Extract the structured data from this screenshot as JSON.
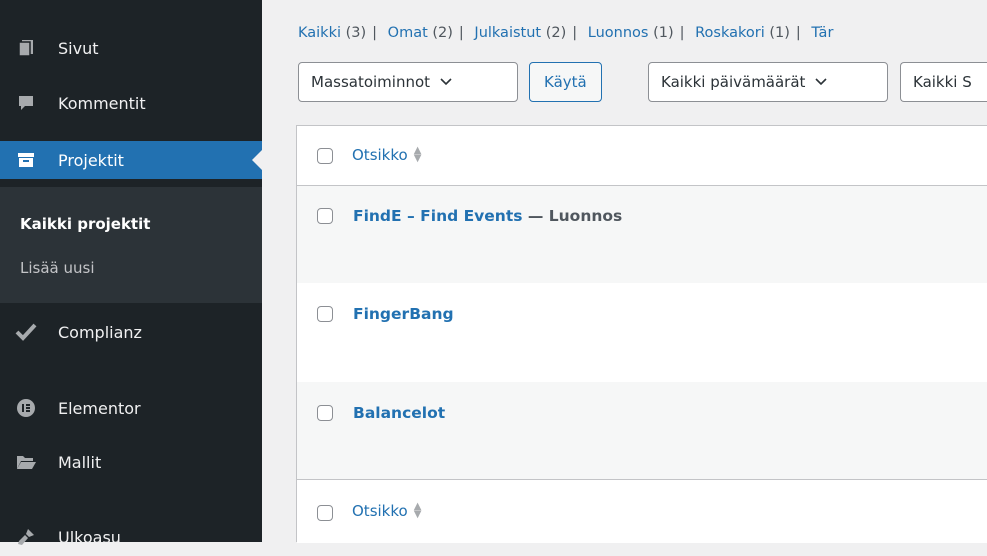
{
  "sidebar": {
    "items": [
      {
        "label": "Sivut",
        "icon": "pages-icon"
      },
      {
        "label": "Kommentit",
        "icon": "comments-icon"
      },
      {
        "label": "Projektit",
        "icon": "projects-icon",
        "active": true
      },
      {
        "label": "Complianz",
        "icon": "checkmark-icon"
      },
      {
        "label": "Elementor",
        "icon": "elementor-icon"
      },
      {
        "label": "Mallit",
        "icon": "folder-icon"
      },
      {
        "label": "Ulkoasu",
        "icon": "brush-icon"
      }
    ],
    "submenu": {
      "current": "Kaikki projektit",
      "add_new": "Lisää uusi"
    }
  },
  "views": [
    {
      "label": "Kaikki",
      "count": "(3)"
    },
    {
      "label": "Omat",
      "count": "(2)"
    },
    {
      "label": "Julkaistut",
      "count": "(2)"
    },
    {
      "label": "Luonnos",
      "count": "(1)"
    },
    {
      "label": "Roskakori",
      "count": "(1)"
    },
    {
      "label": "Tär",
      "count": ""
    }
  ],
  "toolbar": {
    "bulk_actions": "Massatoiminnot",
    "apply": "Käytä",
    "dates": "Kaikki päivämäärät",
    "category": "Kaikki S"
  },
  "table": {
    "column_title": "Otsikko",
    "rows": [
      {
        "title": "FindE – Find Events",
        "state": " — Luonnos"
      },
      {
        "title": "FingerBang",
        "state": ""
      },
      {
        "title": "Balancelot",
        "state": ""
      }
    ]
  },
  "colors": {
    "sidebar_bg": "#1d2327",
    "active_bg": "#2271b1",
    "link": "#2271b1"
  }
}
